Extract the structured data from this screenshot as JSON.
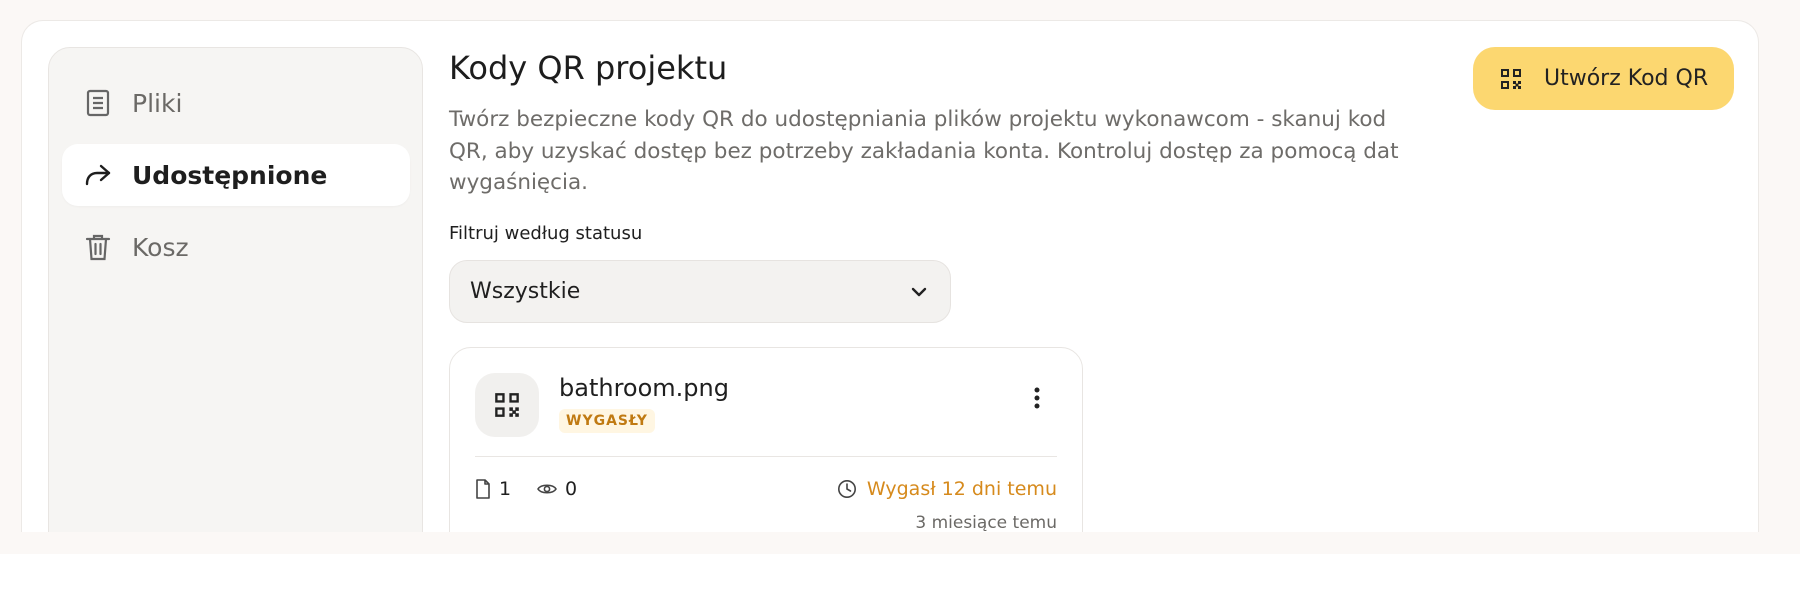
{
  "sidebar": {
    "items": [
      {
        "label": "Pliki",
        "icon": "document-icon",
        "active": false
      },
      {
        "label": "Udostępnione",
        "icon": "share-arrow-icon",
        "active": true
      },
      {
        "label": "Kosz",
        "icon": "trash-icon",
        "active": false
      }
    ]
  },
  "main": {
    "title": "Kody QR projektu",
    "description": "Twórz bezpieczne kody QR do udostępniania plików projektu wykonawcom - skanuj kod QR, aby uzyskać dostęp bez potrzeby zakładania konta. Kontroluj dostęp za pomocą dat wygaśnięcia.",
    "create_button": {
      "label": "Utwórz Kod QR",
      "icon": "qr-code-icon",
      "color": "#fcd770"
    },
    "filter": {
      "label": "Filtruj według statusu",
      "selected": "Wszystkie"
    }
  },
  "cards": [
    {
      "filename": "bathroom.png",
      "status": "WYGASŁY",
      "files_count": "1",
      "views_count": "0",
      "expiry": "Wygasł 12 dni temu",
      "created": "3 miesiące temu",
      "status_color": "#d68a1c"
    }
  ]
}
